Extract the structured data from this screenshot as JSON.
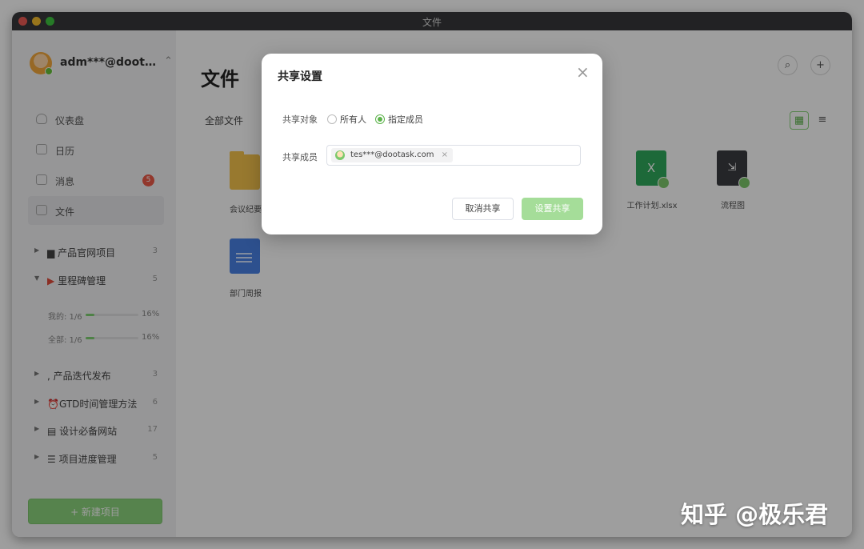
{
  "window": {
    "title": "文件"
  },
  "sidebar": {
    "user": {
      "name": "adm***@doot…"
    },
    "menu": [
      {
        "label": "仪表盘"
      },
      {
        "label": "日历"
      },
      {
        "label": "消息",
        "badge": "5"
      },
      {
        "label": "文件"
      }
    ],
    "projects": [
      {
        "name": "产品官网项目",
        "count": "3",
        "icon": "▆"
      },
      {
        "name": "里程碑管理",
        "count": "5",
        "icon": "▶"
      },
      {
        "name": "产品迭代发布",
        "count": "3",
        "icon": ","
      },
      {
        "name": "GTD时间管理方法",
        "count": "6",
        "icon": "⏰"
      },
      {
        "name": "设计必备网站",
        "count": "17",
        "icon": "▤"
      },
      {
        "name": "项目进度管理",
        "count": "5",
        "icon": "☰"
      }
    ],
    "milestone_progress": [
      {
        "label": "我的: 1/6",
        "pct": "16%",
        "fraction": 0.16
      },
      {
        "label": "全部: 1/6",
        "pct": "16%",
        "fraction": 0.16
      }
    ],
    "new_project_label": "+ 新建项目"
  },
  "main": {
    "title": "文件",
    "breadcrumb": "全部文件",
    "files": [
      {
        "name": "会议纪要",
        "type": "folder"
      },
      {
        "name": "工作计划.xlsx",
        "type": "excel",
        "glyph": "X"
      },
      {
        "name": "流程图",
        "type": "flow",
        "glyph": "⇲"
      },
      {
        "name": "部门周报",
        "type": "doc"
      }
    ]
  },
  "modal": {
    "title": "共享设置",
    "close": "×",
    "share_target_label": "共享对象",
    "options": [
      "所有人",
      "指定成员"
    ],
    "selected_option": "指定成员",
    "members_label": "共享成员",
    "member_tag": "tes***@dootask.com",
    "tag_close": "×",
    "cancel": "取消共享",
    "confirm": "设置共享"
  },
  "watermark": "知乎 @极乐君",
  "colors": {
    "accent": "#8bd47c",
    "badge": "#ec5a47",
    "excel": "#2faa5d",
    "doc": "#4a82e6",
    "folder": "#f6c34c"
  }
}
